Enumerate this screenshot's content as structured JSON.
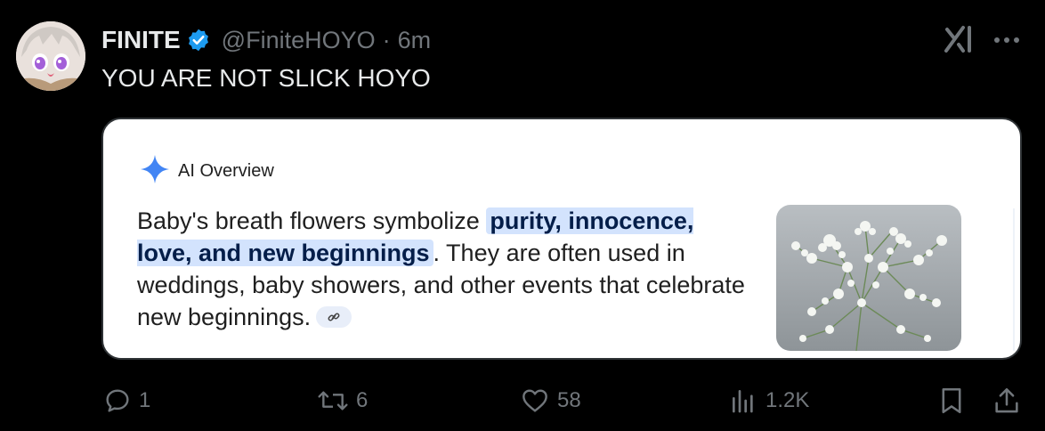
{
  "tweet": {
    "display_name": "FINITE",
    "handle": "@FiniteHOYO",
    "separator": "·",
    "time": "6m",
    "text": "YOU ARE NOT SLICK HOYO"
  },
  "card": {
    "ai_label": "AI Overview",
    "text_before": "Baby's breath flowers symbolize ",
    "highlight": "purity, innocence, love, and new beginnings",
    "text_after": ". They are often used in weddings, baby showers, and other events that celebrate new beginnings.",
    "image_subject": "baby's breath flowers"
  },
  "actions": {
    "replies": "1",
    "reposts": "6",
    "likes": "58",
    "views": "1.2K"
  },
  "icons": [
    "verified-badge-icon",
    "grok-icon",
    "more-icon",
    "sparkle-icon",
    "link-icon",
    "reply-icon",
    "repost-icon",
    "like-icon",
    "views-icon",
    "bookmark-icon",
    "share-icon"
  ],
  "colors": {
    "background": "#000000",
    "text_primary": "#e7e9ea",
    "text_secondary": "#71767b",
    "verified_blue": "#1d9bf0",
    "highlight_bg": "#d3e3fd",
    "sparkle_blue": "#4285f4"
  }
}
